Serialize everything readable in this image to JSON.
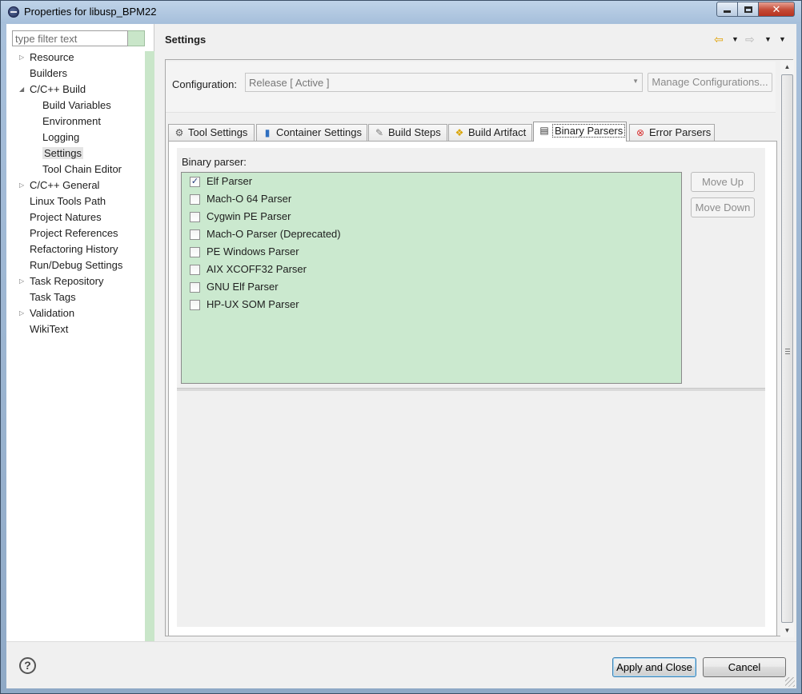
{
  "window": {
    "title": "Properties for libusp_BPM22",
    "controls": {
      "minimize": "minimize",
      "maximize": "maximize",
      "close": "✕"
    }
  },
  "filter": {
    "placeholder": "type filter text"
  },
  "tree": [
    {
      "label": "Resource",
      "level": 0,
      "twisty": "▷"
    },
    {
      "label": "Builders",
      "level": 0,
      "twisty": ""
    },
    {
      "label": "C/C++ Build",
      "level": 0,
      "twisty": "◢"
    },
    {
      "label": "Build Variables",
      "level": 1,
      "twisty": ""
    },
    {
      "label": "Environment",
      "level": 1,
      "twisty": ""
    },
    {
      "label": "Logging",
      "level": 1,
      "twisty": ""
    },
    {
      "label": "Settings",
      "level": 1,
      "twisty": "",
      "selected": true
    },
    {
      "label": "Tool Chain Editor",
      "level": 1,
      "twisty": ""
    },
    {
      "label": "C/C++ General",
      "level": 0,
      "twisty": "▷"
    },
    {
      "label": "Linux Tools Path",
      "level": 0,
      "twisty": ""
    },
    {
      "label": "Project Natures",
      "level": 0,
      "twisty": ""
    },
    {
      "label": "Project References",
      "level": 0,
      "twisty": ""
    },
    {
      "label": "Refactoring History",
      "level": 0,
      "twisty": ""
    },
    {
      "label": "Run/Debug Settings",
      "level": 0,
      "twisty": ""
    },
    {
      "label": "Task Repository",
      "level": 0,
      "twisty": "▷"
    },
    {
      "label": "Task Tags",
      "level": 0,
      "twisty": ""
    },
    {
      "label": "Validation",
      "level": 0,
      "twisty": "▷"
    },
    {
      "label": "WikiText",
      "level": 0,
      "twisty": ""
    }
  ],
  "header": {
    "title": "Settings"
  },
  "nav": {
    "back": "⇦",
    "forward": "⇨",
    "dropdown": "▼"
  },
  "configuration": {
    "label": "Configuration:",
    "value": "Release  [ Active ]",
    "manage_label": "Manage Configurations..."
  },
  "tabs": [
    {
      "label": "Tool Settings",
      "icon": "⚙",
      "icon_name": "tool-settings-icon",
      "icon_color": "#555555"
    },
    {
      "label": "Container Settings",
      "icon": "▮",
      "icon_name": "container-icon",
      "icon_color": "#2f6fc0"
    },
    {
      "label": "Build Steps",
      "icon": "✎",
      "icon_name": "build-steps-icon",
      "icon_color": "#7a7a7a"
    },
    {
      "label": "Build Artifact",
      "icon": "❖",
      "icon_name": "build-artifact-icon",
      "icon_color": "#d9a400"
    },
    {
      "label": "Binary Parsers",
      "icon": "▤",
      "icon_name": "binary-parsers-icon",
      "icon_color": "#333333",
      "active": true
    },
    {
      "label": "Error Parsers",
      "icon": "⊗",
      "icon_name": "error-parsers-icon",
      "icon_color": "#d62d2d"
    }
  ],
  "binary_parsers": {
    "label": "Binary parser:",
    "items": [
      {
        "label": "Elf Parser",
        "checked": true
      },
      {
        "label": "Mach-O 64 Parser",
        "checked": false
      },
      {
        "label": "Cygwin PE Parser",
        "checked": false
      },
      {
        "label": "Mach-O Parser (Deprecated)",
        "checked": false
      },
      {
        "label": "PE Windows Parser",
        "checked": false
      },
      {
        "label": "AIX XCOFF32 Parser",
        "checked": false
      },
      {
        "label": "GNU Elf Parser",
        "checked": false
      },
      {
        "label": "HP-UX SOM Parser",
        "checked": false
      }
    ],
    "move_up": "Move Up",
    "move_down": "Move Down"
  },
  "footer": {
    "help": "?",
    "apply_close": "Apply and Close",
    "cancel": "Cancel"
  },
  "colors": {
    "list_background": "#cbe9cf",
    "filter_accent": "#c9e6c9",
    "close_button": "#c44a36"
  }
}
